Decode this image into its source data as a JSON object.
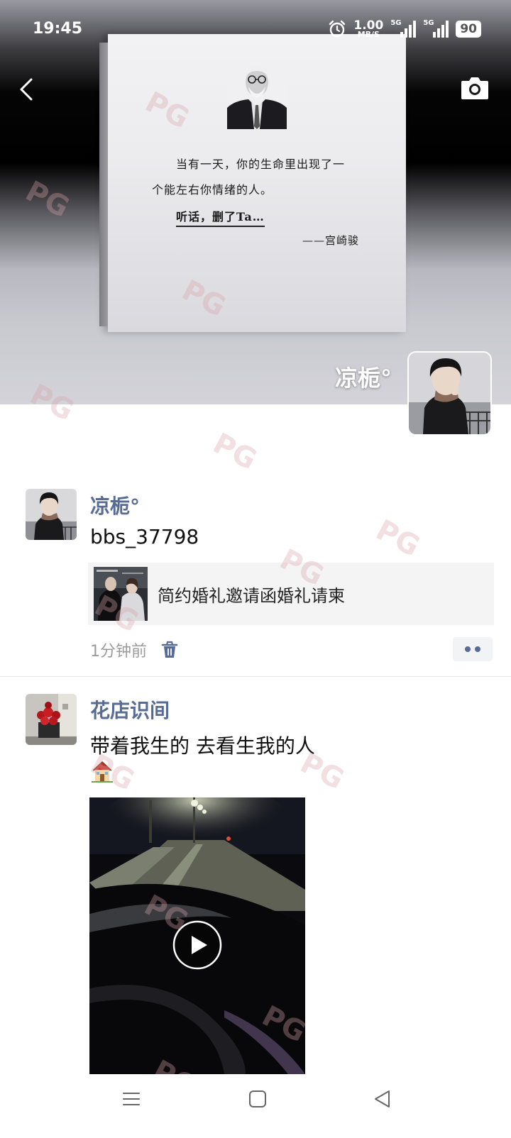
{
  "status_bar": {
    "time": "19:45",
    "speed_value": "1.00",
    "speed_unit": "MB/S",
    "signal_1_label": "5G",
    "signal_2_label": "5G",
    "battery": "90"
  },
  "cover": {
    "quote_line_1": "当有一天，你的生命里出现了一",
    "quote_line_2": "个能左右你情绪的人。",
    "quote_line_3": "听话，删了Ta…",
    "quote_author": "——宫崎骏",
    "profile_name": "凉栀°"
  },
  "posts": [
    {
      "author": "凉栀°",
      "text": "bbs_37798",
      "link_title": "简约婚礼邀请函婚礼请柬",
      "time_ago": "1分钟前"
    },
    {
      "author": "花店识间",
      "text": "带着我生的 去看生我的人",
      "emoji": "house-icon"
    }
  ],
  "watermark": "PG"
}
